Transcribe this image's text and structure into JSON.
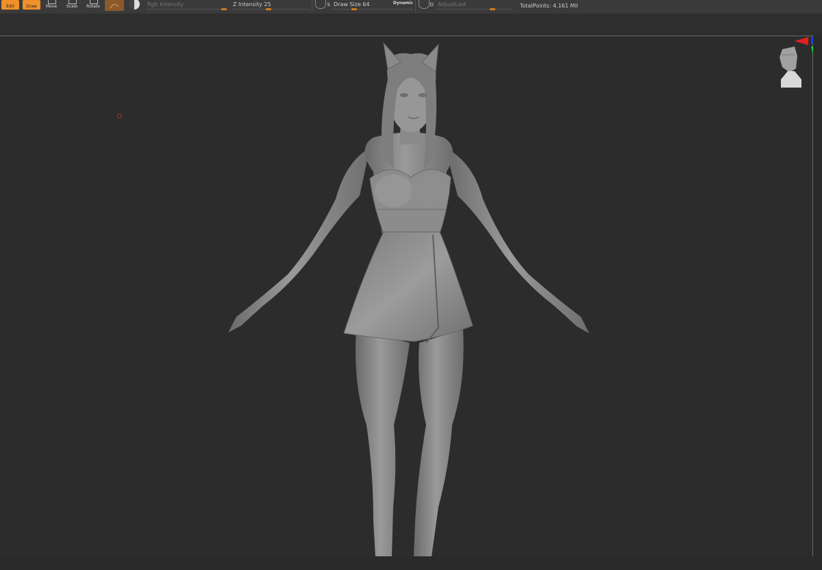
{
  "toolbar": {
    "edit_label": "Edit",
    "draw_label": "Draw",
    "move_label": "Move",
    "scale_label": "Scale",
    "rotate_label": "Rotate",
    "rgb_intensity_label": "Rgb Intensity",
    "z_intensity_label": "Z Intensity",
    "z_intensity_value": "25",
    "s_label": "S",
    "draw_size_label": "Draw Size",
    "draw_size_value": "64",
    "dynamic_label": "Dynamic",
    "d_label": "D",
    "adjust_last_label": "AdjustLast",
    "total_points": "TotalPoints: 4.161 Mil"
  },
  "icons": {
    "material": "material-sphere-icon",
    "navigation": "navigation-head-icon",
    "gizmo": "axis-gizmo-icon"
  },
  "colors": {
    "accent": "#f0902a",
    "background": "#2c2c2c",
    "toolbar": "#3a3a3a",
    "model": "#8a8a8a"
  }
}
